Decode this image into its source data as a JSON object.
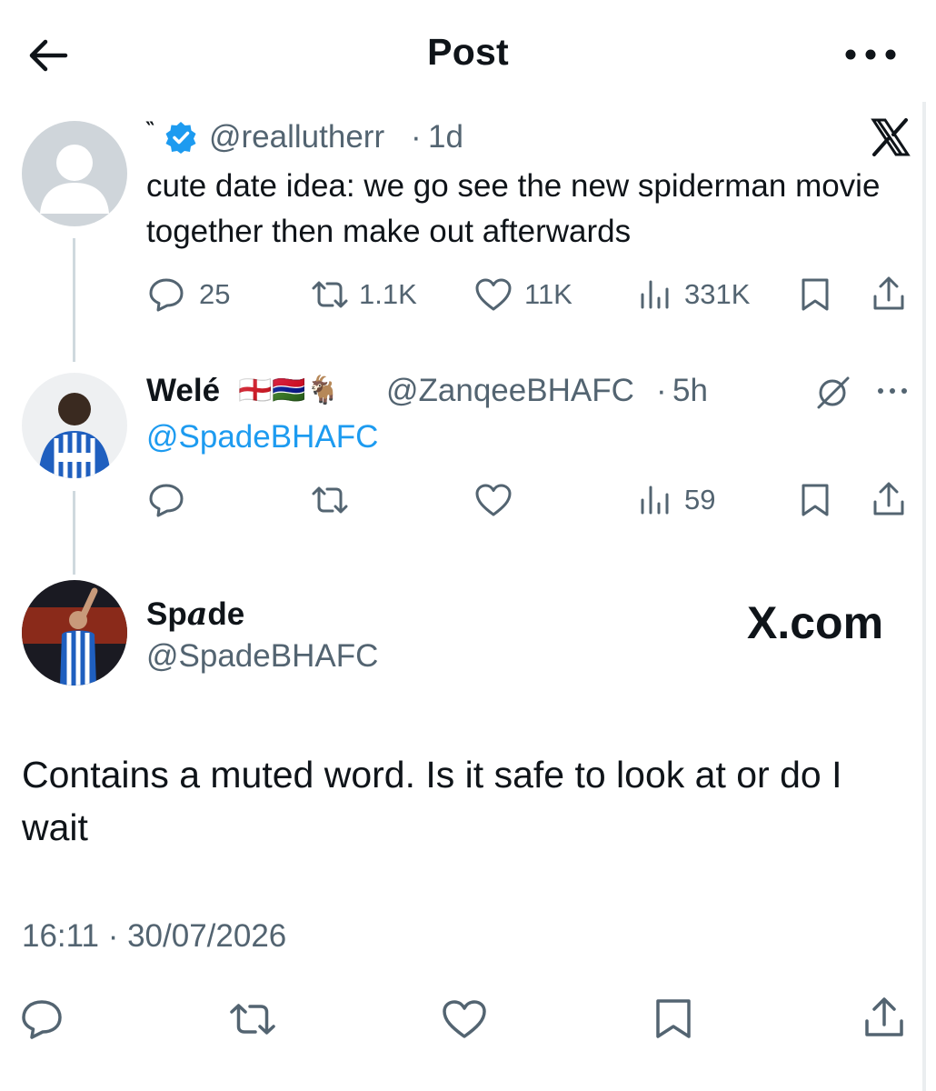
{
  "header": {
    "title": "Post",
    "back_icon": "back-arrow-icon",
    "more_icon": "more-horizontal-icon"
  },
  "quoted_tweet": {
    "display_name": "‶",
    "verified_icon": "verified-badge-icon",
    "handle": "@reallutherr",
    "time": "1d",
    "text": "cute date idea: we go see the new spiderman movie together then make out afterwards",
    "logo": "X",
    "actions": {
      "replies": "25",
      "reposts": "1.1K",
      "likes": "11K",
      "views": "331K"
    }
  },
  "reply_tweet": {
    "display_name": "Welé",
    "emojis": "🏴󠁧󠁢󠁥󠁮󠁧󠁿🇬🇲🐐",
    "handle": "@ZanqeeBHAFC",
    "time": "5h",
    "mention": "@SpadeBHAFC",
    "actions": {
      "views": "59"
    }
  },
  "main_tweet": {
    "display_name_1": "Sp",
    "display_name_2": "a",
    "display_name_3": "de",
    "handle": "@SpadeBHAFC",
    "watermark": "X.com",
    "text": "Contains a muted word. Is it safe to look at or do I wait",
    "timestamp": "16:11 · 30/07/2026"
  },
  "colors": {
    "text_primary": "#0f1419",
    "text_secondary": "#536471",
    "link": "#1d9bf0",
    "thread_line": "#cfd9de"
  }
}
